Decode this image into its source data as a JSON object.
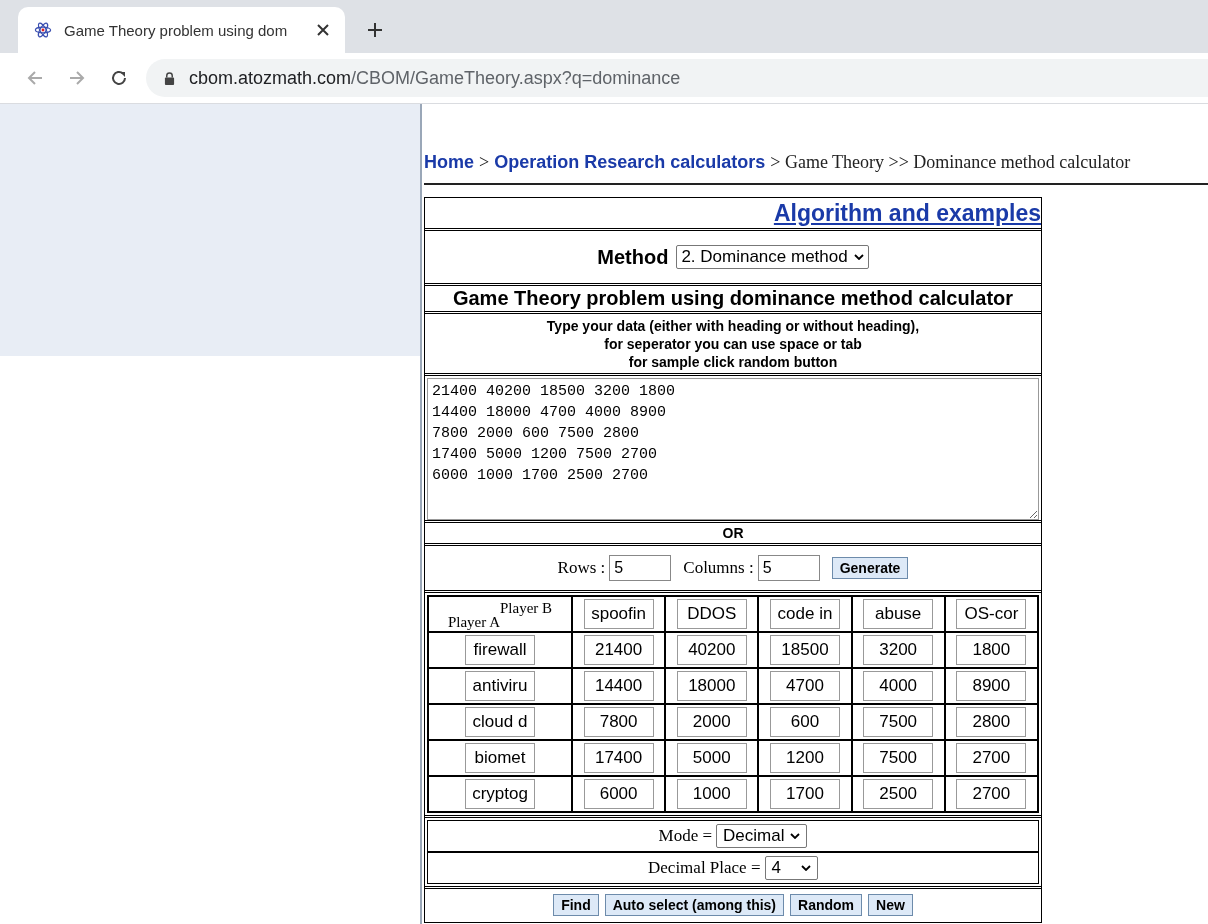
{
  "browser": {
    "tab_title": "Game Theory problem using dom",
    "address_host": "cbom.atozmath.com",
    "address_path": "/CBOM/GameTheory.aspx?q=dominance"
  },
  "breadcrumb": [
    {
      "text": "Home",
      "kind": "link"
    },
    {
      "text": ">",
      "kind": "sep"
    },
    {
      "text": "Operation Research calculators",
      "kind": "link"
    },
    {
      "text": "> Game Theory >> Dominance method calculator",
      "kind": "plain"
    }
  ],
  "algorithm_link": "Algorithm and examples",
  "method": {
    "label": "Method",
    "value": "2. Dominance method"
  },
  "heading": "Game Theory problem using dominance method calculator",
  "instructions": [
    "Type your data (either with heading or without heading),",
    "for seperator you can use space or tab",
    "for sample click random button"
  ],
  "data_text": "21400 40200 18500 3200 1800\n14400 18000 4700 4000 8900\n7800 2000 600 7500 2800\n17400 5000 1200 7500 2700\n6000 1000 1700 2500 2700",
  "or_label": "OR",
  "size": {
    "rows_label": "Rows :",
    "rows": "5",
    "columns_label": "Columns :",
    "columns": "5",
    "generate": "Generate"
  },
  "matrix": {
    "player_b": "Player B",
    "player_a": "Player A",
    "columns": [
      "spoofin",
      "DDOS",
      "code in",
      "abuse",
      "OS-cor"
    ],
    "rows": [
      {
        "label": "firewall",
        "values": [
          "21400",
          "40200",
          "18500",
          "3200",
          "1800"
        ]
      },
      {
        "label": "antiviru",
        "values": [
          "14400",
          "18000",
          "4700",
          "4000",
          "8900"
        ]
      },
      {
        "label": "cloud d",
        "values": [
          "7800",
          "2000",
          "600",
          "7500",
          "2800"
        ]
      },
      {
        "label": "biomet",
        "values": [
          "17400",
          "5000",
          "1200",
          "7500",
          "2700"
        ]
      },
      {
        "label": "cryptog",
        "values": [
          "6000",
          "1000",
          "1700",
          "2500",
          "2700"
        ]
      }
    ]
  },
  "mode": {
    "label": "Mode =",
    "value": "Decimal"
  },
  "decimal_place": {
    "label": "Decimal Place =",
    "value": "4"
  },
  "buttons": [
    "Find",
    "Auto select (among this)",
    "Random",
    "New"
  ]
}
